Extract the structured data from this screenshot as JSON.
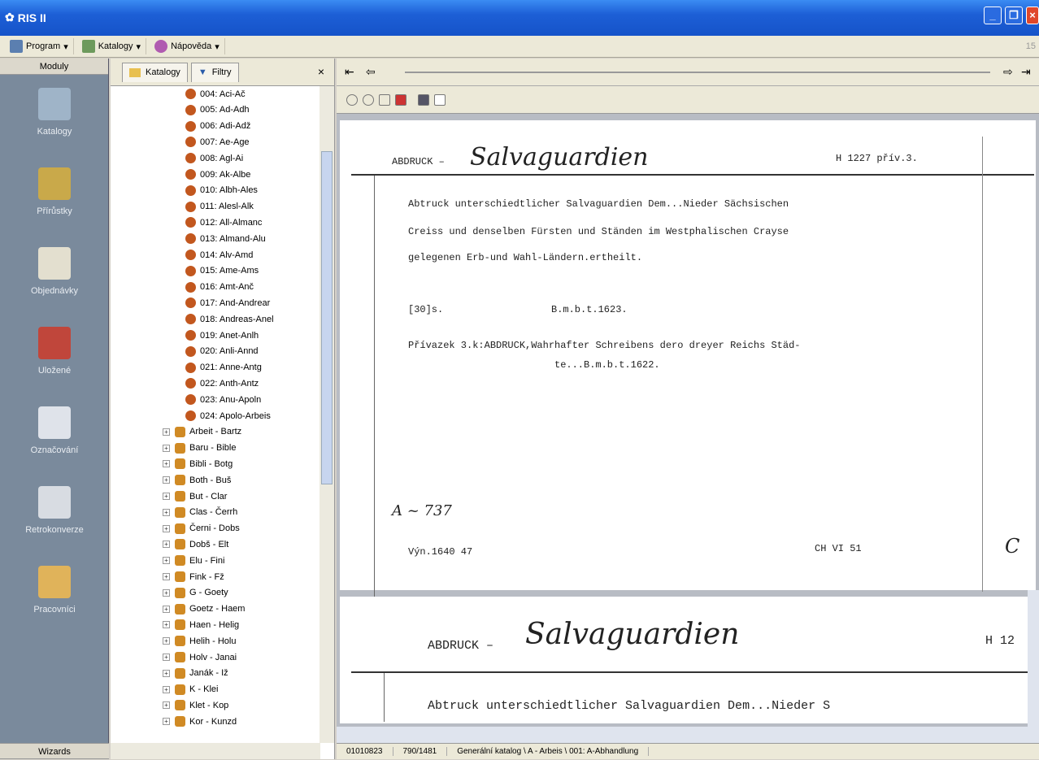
{
  "app": {
    "title": "RIS II"
  },
  "menu": {
    "program": "Program",
    "katalogy": "Katalogy",
    "napoveda": "Nápověda",
    "counter": "15"
  },
  "modules": {
    "header": "Moduly",
    "footer": "Wizards",
    "items": [
      {
        "label": "Katalogy",
        "icon": "catalog-icon"
      },
      {
        "label": "Přírůstky",
        "icon": "accessions-icon"
      },
      {
        "label": "Objednávky",
        "icon": "orders-icon"
      },
      {
        "label": "Uložené",
        "icon": "saved-icon"
      },
      {
        "label": "Označování",
        "icon": "labeling-icon"
      },
      {
        "label": "Retrokonverze",
        "icon": "retroconversion-icon"
      },
      {
        "label": "Pracovníci",
        "icon": "workers-icon"
      }
    ]
  },
  "tree": {
    "tab_katalogy": "Katalogy",
    "tab_filtry": "Filtry",
    "close": "×",
    "sub_items": [
      "004: Aci-Ač",
      "005: Ad-Adh",
      "006: Adi-Adž",
      "007: Ae-Age",
      "008: Agl-Ai",
      "009: Ak-Albe",
      "010: Albh-Ales",
      "011: Alesl-Alk",
      "012: All-Almanc",
      "013: Almand-Alu",
      "014: Alv-Amd",
      "015: Ame-Ams",
      "016: Amt-Anč",
      "017: And-Andrear",
      "018: Andreas-Anel",
      "019: Anet-Anlh",
      "020: Anli-Annd",
      "021: Anne-Antg",
      "022: Anth-Antz",
      "023: Anu-Apoln",
      "024: Apolo-Arbeis"
    ],
    "groups": [
      "Arbeit - Bartz",
      "Baru - Bible",
      "Bibli - Botg",
      "Both - Buš",
      "But - Clar",
      "Clas - Čerrh",
      "Černi - Dobs",
      "Dobš - Elt",
      "Elu - Fini",
      "Fink - Fž",
      "G - Goety",
      "Goetz - Haem",
      "Haen - Helig",
      "Helih - Holu",
      "Holv - Janai",
      "Janák - Iž",
      "K - Klei",
      "Klet - Kop",
      "Kor - Kunzd"
    ]
  },
  "viewer": {
    "card1": {
      "header_label": "ABDRUCK –",
      "header_hand": "Salvaguardien",
      "signature": "H 1227 přív.3.",
      "line1": "Abtruck unterschiedtlicher Salvaguardien Dem...Nieder Sächsischen",
      "line2": "Creiss und denselben Fürsten und Ständen im Westphalischen Crayse",
      "line3": "gelegenen Erb-und Wahl-Ländern.ertheilt.",
      "pages": "[30]s.",
      "imprint": "B.m.b.t.1623.",
      "note1": "Přívazek 3.k:ABDRUCK,Wahrhafter  Schreibens dero dreyer Reichs Städ-",
      "note2": "te...B.m.b.t.1622.",
      "hand_note": "A ~ 737",
      "footer_left": "Výn.1640 47",
      "footer_mid": "CH VI 51",
      "footer_right": "C"
    },
    "card2": {
      "header_label": "ABDRUCK –",
      "header_hand": "Salvaguardien",
      "signature": "H 12",
      "line1": "Abtruck unterschiedtlicher Salvaguardien Dem...Nieder S"
    }
  },
  "status": {
    "id": "01010823",
    "position": "790/1481",
    "path": "Generální katalog \\ A - Arbeis \\ 001: A-Abhandlung"
  }
}
